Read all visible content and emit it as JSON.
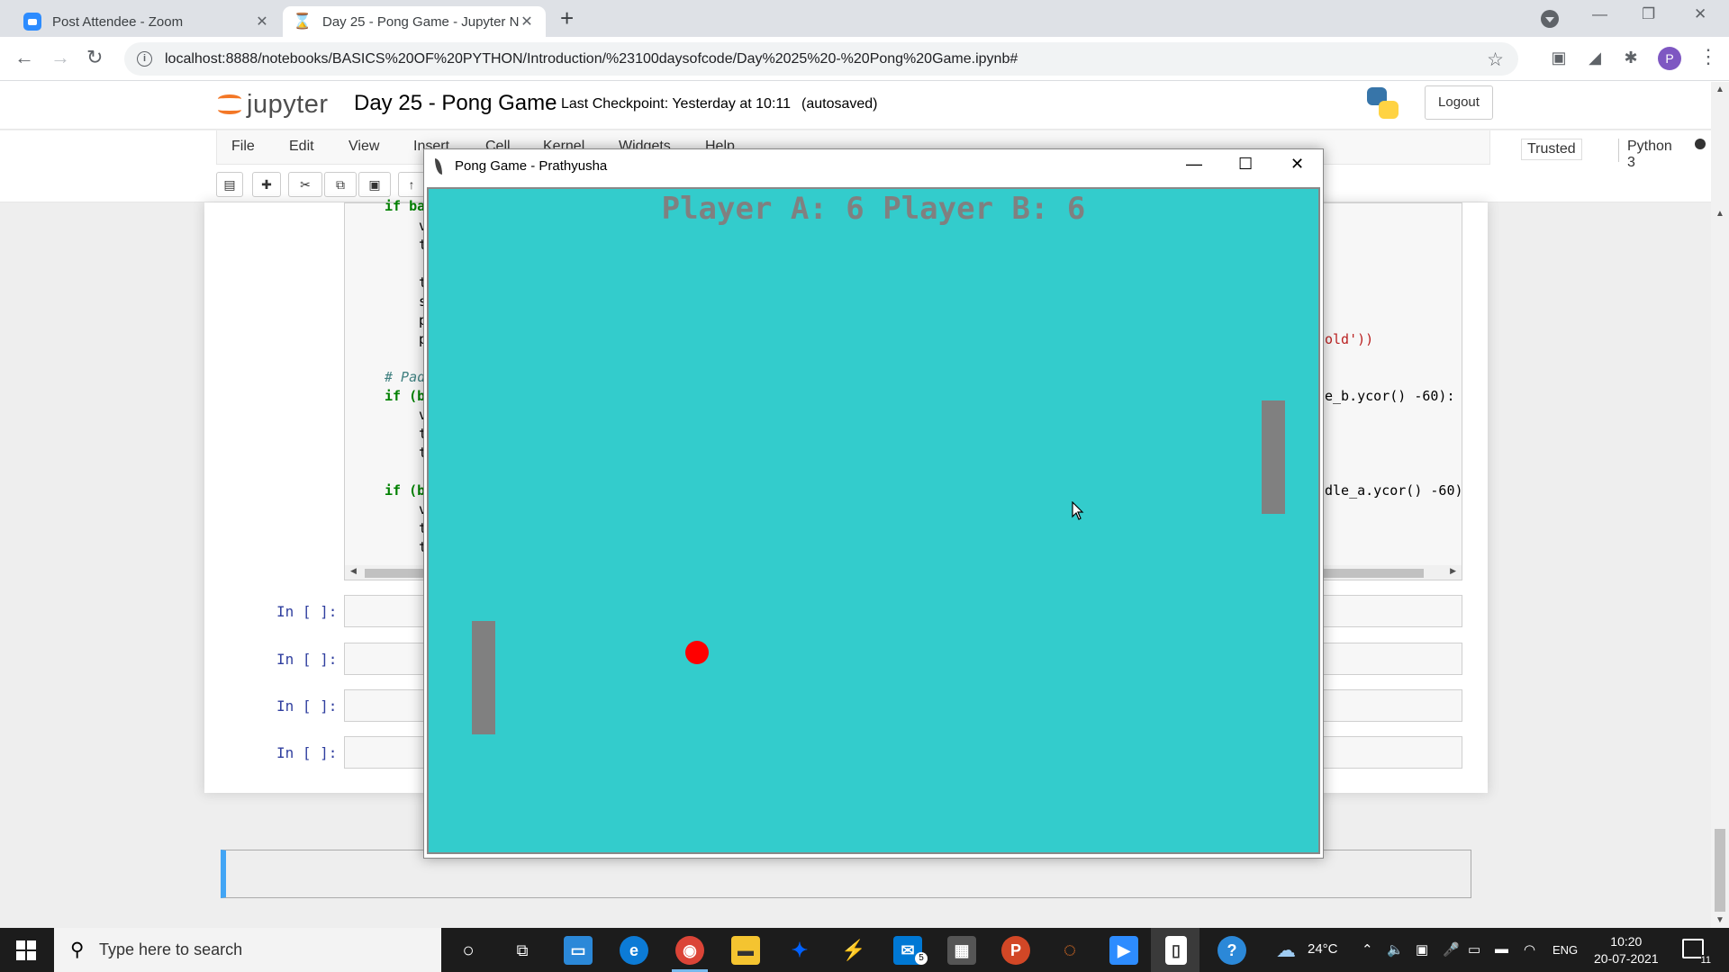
{
  "browser": {
    "tabs": [
      {
        "title": "Post Attendee - Zoom",
        "icon": "zoom-icon"
      },
      {
        "title": "Day 25 - Pong Game - Jupyter N",
        "icon": "hourglass-icon"
      }
    ],
    "url": "localhost:8888/notebooks/BASICS%20OF%20PYTHON/Introduction/%23100daysofcode/Day%2025%20-%20Pong%20Game.ipynb#",
    "profile_initial": "P"
  },
  "jupyter": {
    "logo_text": "jupyter",
    "notebook_title": "Day 25 - Pong Game",
    "checkpoint": "Last Checkpoint: Yesterday at 10:11",
    "autosaved": "(autosaved)",
    "logout_label": "Logout",
    "menu": [
      "File",
      "Edit",
      "View",
      "Insert",
      "Cell",
      "Kernel",
      "Widgets",
      "Help"
    ],
    "trusted_label": "Trusted",
    "kernel_name": "Python 3",
    "code_fragments": {
      "if_top": "if ba",
      "comment": "# Pad",
      "if1": "if (b",
      "if2": "if (b",
      "right1": "old'))",
      "right2": "e_b.ycor() -60):",
      "right3": "dle_a.ycor() -60)"
    },
    "empty_prompt": "In [ ]:"
  },
  "game_window": {
    "title": "Pong Game - Prathyusha",
    "score_text": "Player A:  6  Player B:  6",
    "colors": {
      "background": "#33cccc",
      "paddle": "#808080",
      "ball": "#ff0000",
      "score": "#808080"
    }
  },
  "taskbar": {
    "search_placeholder": "Type here to search",
    "weather": "24°C",
    "language": "ENG",
    "time": "10:20",
    "date": "20-07-2021",
    "mail_badge": "5",
    "notification_count": "11"
  }
}
